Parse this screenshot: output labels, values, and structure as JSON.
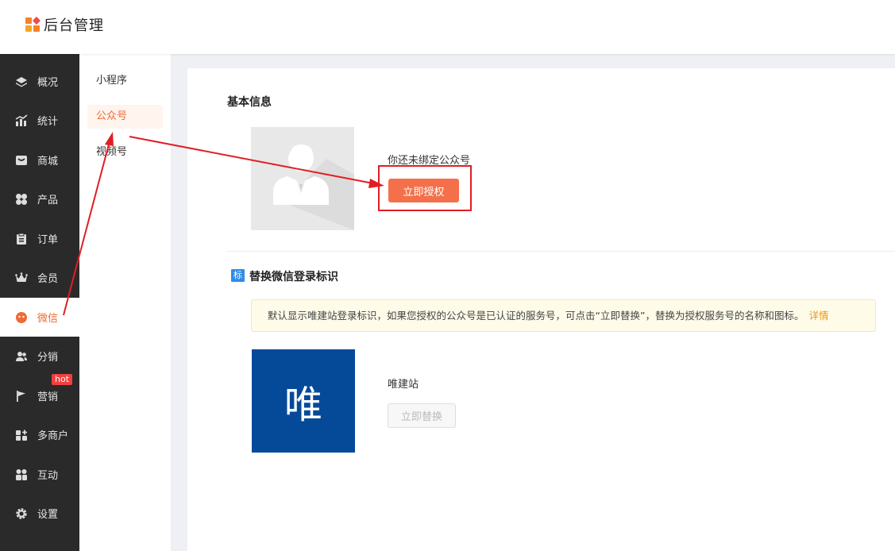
{
  "app": {
    "title": "后台管理"
  },
  "sidebar": {
    "items": [
      {
        "label": "概况",
        "icon": "layers-icon"
      },
      {
        "label": "统计",
        "icon": "chart-icon"
      },
      {
        "label": "商城",
        "icon": "mall-icon"
      },
      {
        "label": "产品",
        "icon": "grid-icon"
      },
      {
        "label": "订单",
        "icon": "clipboard-icon"
      },
      {
        "label": "会员",
        "icon": "crown-icon"
      },
      {
        "label": "微信",
        "icon": "wechat-icon",
        "active": true
      },
      {
        "label": "分销",
        "icon": "users-icon"
      },
      {
        "label": "营销",
        "icon": "flag-icon",
        "badge": "hot"
      },
      {
        "label": "多商户",
        "icon": "store-plus-icon"
      },
      {
        "label": "互动",
        "icon": "interact-icon"
      },
      {
        "label": "设置",
        "icon": "gear-icon"
      }
    ]
  },
  "subnav": {
    "items": [
      {
        "label": "小程序"
      },
      {
        "label": "公众号",
        "active": true
      },
      {
        "label": "视频号"
      }
    ]
  },
  "basic": {
    "title": "基本信息",
    "status_text": "你还未绑定公众号",
    "auth_button": "立即授权"
  },
  "replace": {
    "tag": "标",
    "title": "替换微信登录标识",
    "notice": "默认显示唯建站登录标识，如果您授权的公众号是已认证的服务号，可点击“立即替换”，替换为授权服务号的名称和图标。",
    "notice_link": "详情",
    "brand_char": "唯",
    "brand_name": "唯建站",
    "replace_button": "立即替换"
  },
  "colors": {
    "accent": "#f06a35",
    "sidebar_bg": "#2a2a2a",
    "brand_bg": "#054a99",
    "annotation": "#e01e24"
  }
}
